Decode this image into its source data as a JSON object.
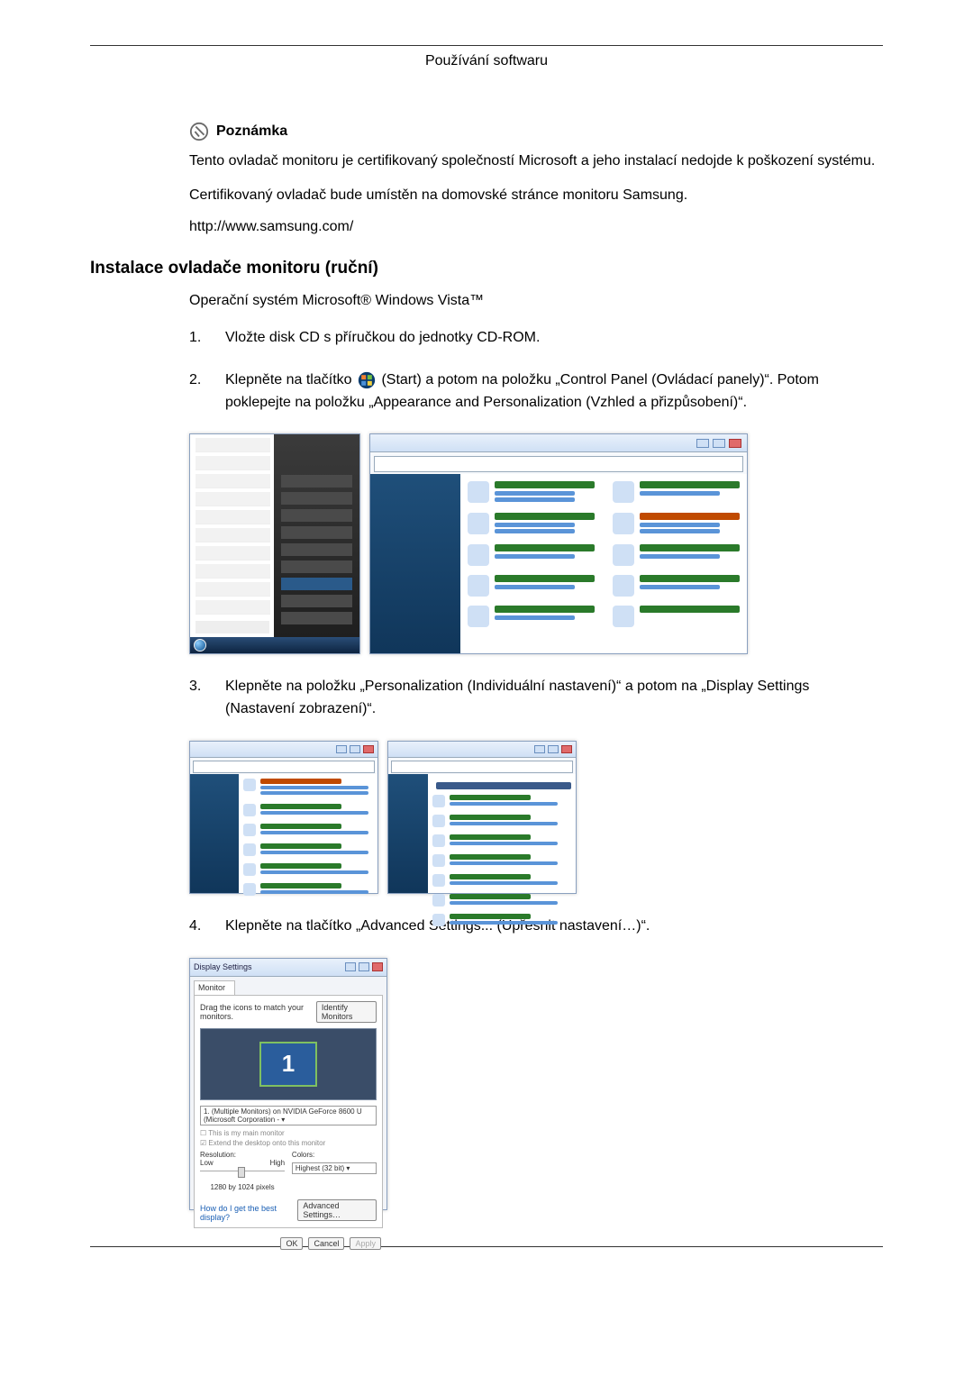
{
  "page_header": "Používání softwaru",
  "note": {
    "title": "Poznámka",
    "p1": "Tento ovladač monitoru je certifikovaný společností Microsoft a jeho instalací nedojde k poškození systému.",
    "p2": "Certifikovaný ovladač bude umístěn na domovské stránce monitoru Samsung.",
    "url": "http://www.samsung.com/"
  },
  "h2": "Instalace ovladače monitoru (ruční)",
  "subtitle": "Operační systém Microsoft® Windows Vista™",
  "steps": {
    "1": {
      "num": "1.",
      "text": "Vložte disk CD s příručkou do jednotky CD-ROM."
    },
    "2": {
      "num": "2.",
      "pre": "Klepněte na tlačítko ",
      "post": "(Start) a potom na položku „Control Panel (Ovládací panely)“. Potom poklepejte na položku „Appearance and Personalization (Vzhled a přizpůsobení)“."
    },
    "3": {
      "num": "3.",
      "text": "Klepněte na položku „Personalization (Individuální nastavení)“ a potom na „Display Settings (Nastavení zobrazení)“."
    },
    "4": {
      "num": "4.",
      "text": "Klepněte na tlačítko „Advanced Settings... (Upřesnit nastavení…)“."
    }
  },
  "display_settings": {
    "title": "Display Settings",
    "tab": "Monitor",
    "drag_label": "Drag the icons to match your monitors.",
    "identify": "Identify Monitors",
    "monitor_num": "1",
    "combo": "1. (Multiple Monitors) on NVIDIA GeForce 8600 U (Microsoft Corporation - ▾",
    "chk1": "☐ This is my main monitor",
    "chk2": "☑ Extend the desktop onto this monitor",
    "res_label": "Resolution:",
    "res_low": "Low",
    "res_high": "High",
    "res_value": "1280 by 1024 pixels",
    "colors_label": "Colors:",
    "colors_value": "Highest (32 bit)   ▾",
    "link": "How do I get the best display?",
    "advanced": "Advanced Settings…",
    "ok": "OK",
    "cancel": "Cancel",
    "apply": "Apply"
  }
}
